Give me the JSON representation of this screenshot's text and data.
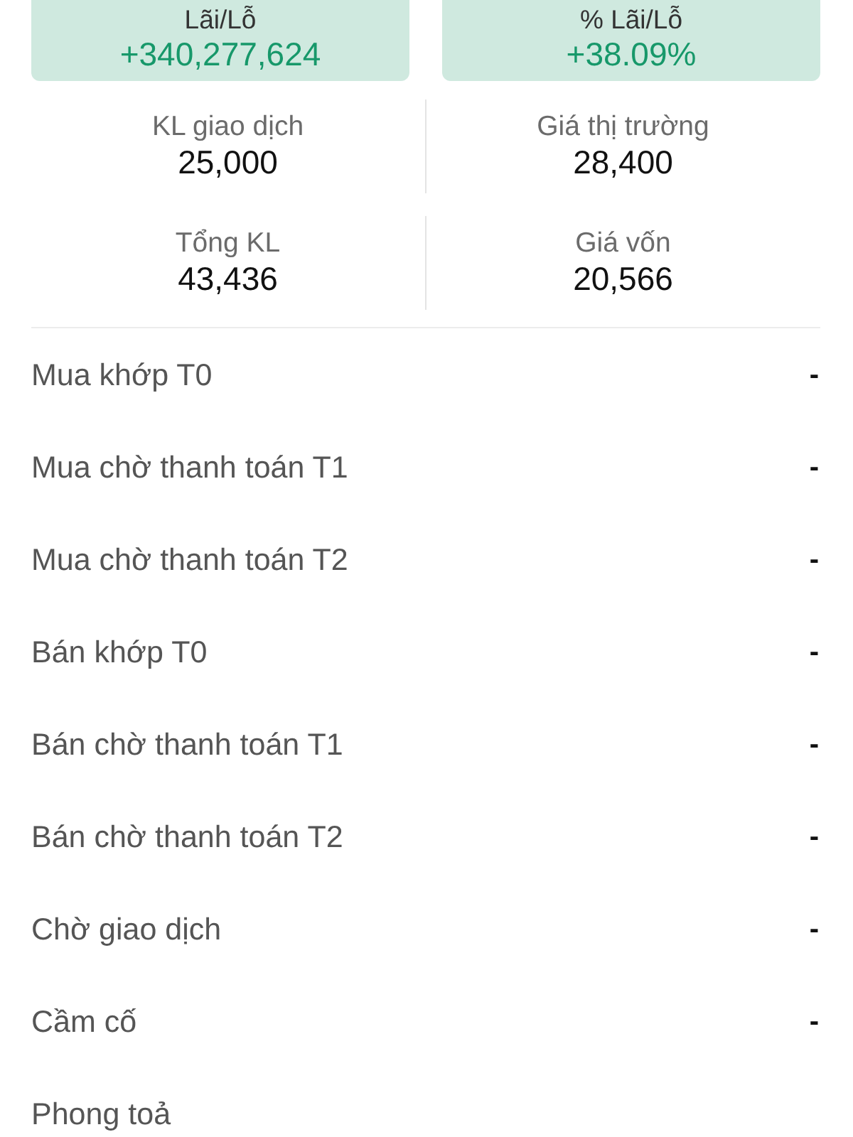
{
  "summary_cards": [
    {
      "label": "Lãi/Lỗ",
      "value": "+340,277,624"
    },
    {
      "label": "% Lãi/Lỗ",
      "value": "+38.09%"
    }
  ],
  "stats": [
    {
      "label": "KL giao dịch",
      "value": "25,000"
    },
    {
      "label": "Giá thị trường",
      "value": "28,400"
    },
    {
      "label": "Tổng KL",
      "value": "43,436"
    },
    {
      "label": "Giá vốn",
      "value": "20,566"
    }
  ],
  "details": [
    {
      "label": "Mua khớp T0",
      "value": "-"
    },
    {
      "label": "Mua chờ thanh toán T1",
      "value": "-"
    },
    {
      "label": "Mua chờ thanh toán T2",
      "value": "-"
    },
    {
      "label": "Bán khớp T0",
      "value": "-"
    },
    {
      "label": "Bán chờ thanh toán T1",
      "value": "-"
    },
    {
      "label": "Bán chờ thanh toán T2",
      "value": "-"
    },
    {
      "label": "Chờ giao dịch",
      "value": "-"
    },
    {
      "label": "Cầm cố",
      "value": "-"
    },
    {
      "label": "Phong toả"
    }
  ]
}
